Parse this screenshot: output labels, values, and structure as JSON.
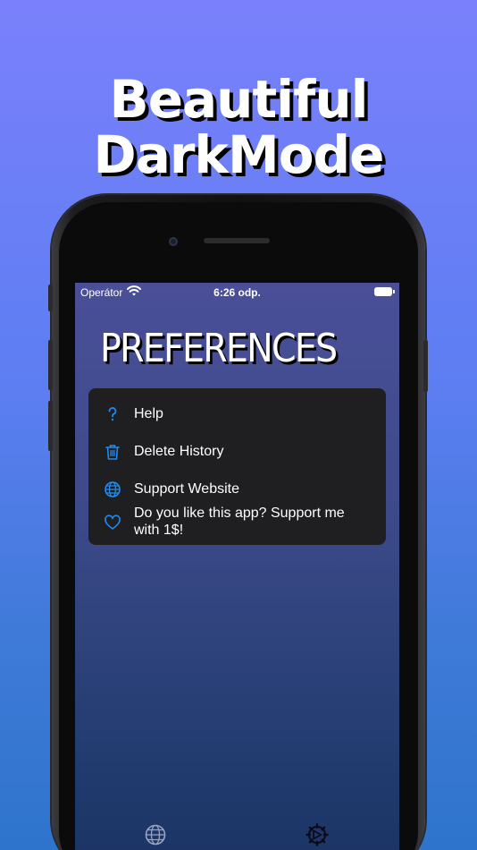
{
  "headline": {
    "line1": "Beautiful",
    "line2": "DarkMode"
  },
  "status_bar": {
    "carrier": "Operátor",
    "time": "6:26 odp."
  },
  "screen_title": "PREFERENCES",
  "menu": {
    "items": [
      {
        "label": "Help",
        "icon": "question-icon"
      },
      {
        "label": "Delete History",
        "icon": "trash-icon"
      },
      {
        "label": "Support Website",
        "icon": "globe-icon"
      },
      {
        "label": "Do you like this app? Support me with 1$!",
        "icon": "heart-icon"
      }
    ]
  },
  "tab_bar": {
    "tabs": [
      {
        "icon": "globe-icon"
      },
      {
        "icon": "gear-icon"
      }
    ]
  },
  "colors": {
    "accent": "#1e8cf0",
    "menu_bg": "#1f1f22",
    "page_bg_top": "#7a80fb",
    "page_bg_bottom": "#2e74cc"
  }
}
